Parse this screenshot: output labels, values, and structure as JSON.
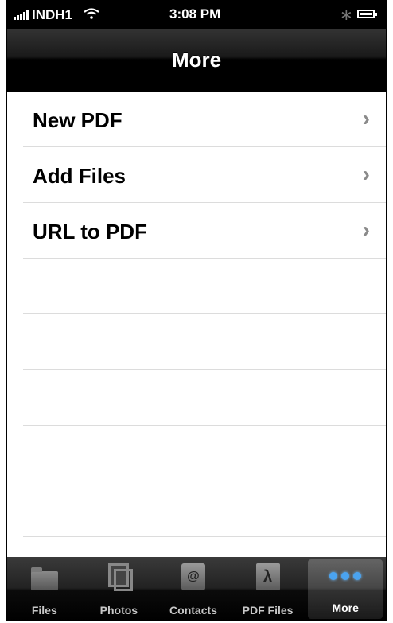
{
  "status_bar": {
    "carrier": "INDH1",
    "time": "3:08 PM",
    "bluetooth_icon": "bluetooth-icon",
    "battery_icon": "battery-icon",
    "wifi_icon": "wifi-icon",
    "signal_icon": "signal-bars-icon"
  },
  "nav": {
    "title": "More"
  },
  "list": {
    "items": [
      {
        "label": "New PDF",
        "icon": "chevron-right-icon"
      },
      {
        "label": "Add Files",
        "icon": "chevron-right-icon"
      },
      {
        "label": "URL to PDF",
        "icon": "chevron-right-icon"
      }
    ]
  },
  "tabs": [
    {
      "label": "Files",
      "icon": "folder-icon"
    },
    {
      "label": "Photos",
      "icon": "photos-icon"
    },
    {
      "label": "Contacts",
      "icon": "contacts-icon"
    },
    {
      "label": "PDF Files",
      "icon": "pdf-icon"
    },
    {
      "label": "More",
      "icon": "more-dots-icon",
      "active": true
    }
  ],
  "colors": {
    "tab_active_dots": "#4aa3f0",
    "nav_background": "#000000",
    "separator": "#dcdcdc"
  }
}
